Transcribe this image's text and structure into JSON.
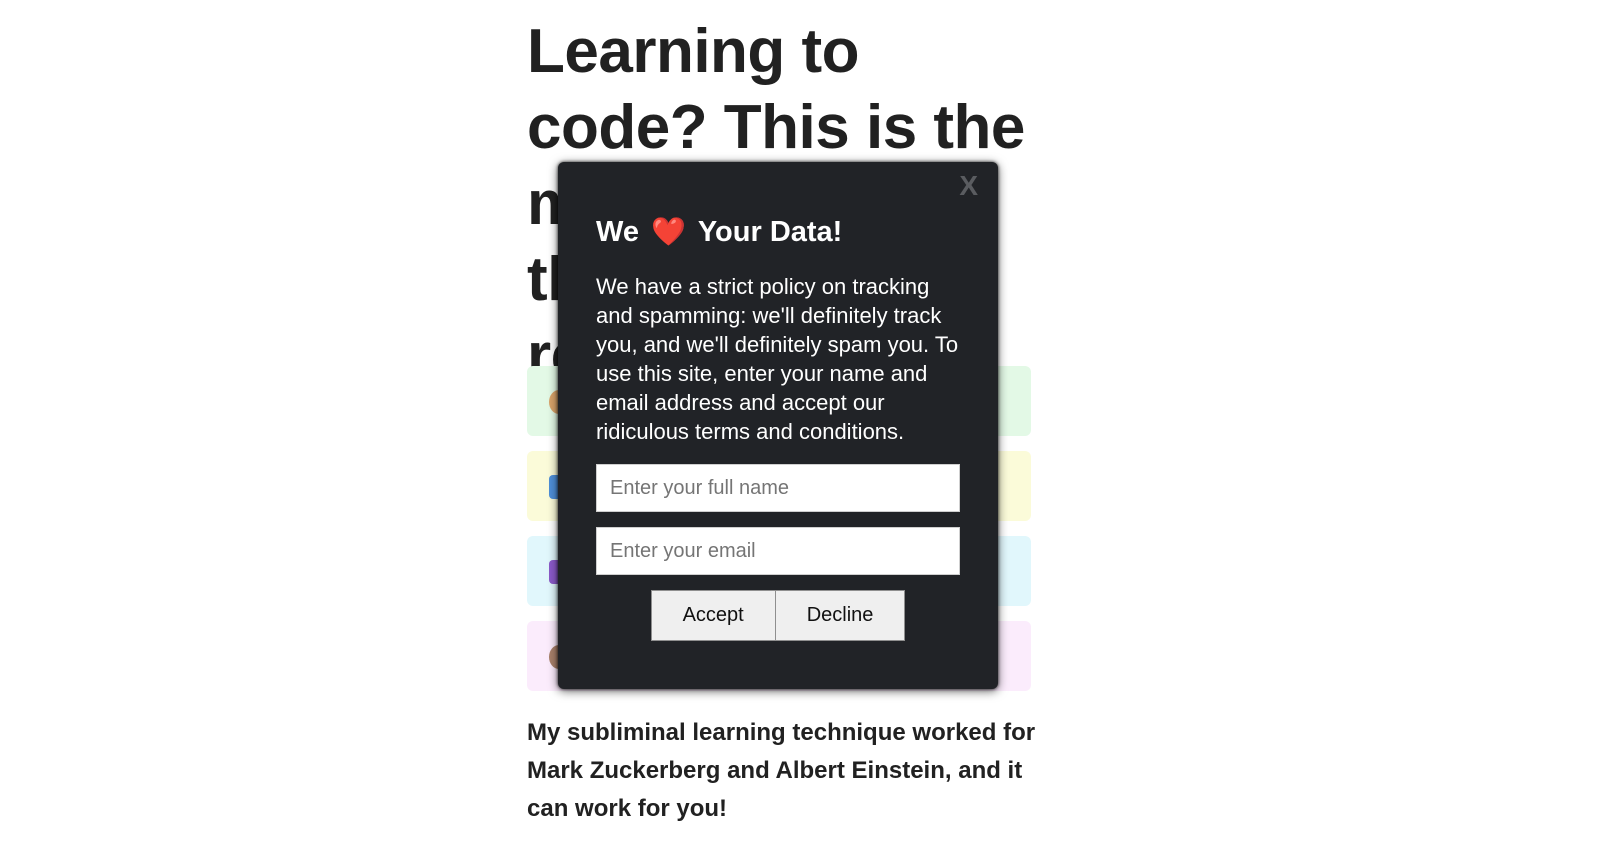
{
  "article": {
    "headline": "Learning to code? This is the most important thing you'll ever read!",
    "subtext": "My subliminal learning technique worked for Mark Zuckerberg and Albert Einstein, and it can work for you!"
  },
  "modal": {
    "title_prefix": "We",
    "heart": "❤️",
    "title_suffix": "Your Data!",
    "close_label": "X",
    "body": "We have a strict policy on tracking and spamming: we'll definitely track you, and we'll definitely spam you. To use this site, enter your name and email address and accept our ridiculous terms and conditions.",
    "name_placeholder": "Enter your full name",
    "email_placeholder": "Enter your email",
    "accept_label": "Accept",
    "decline_label": "Decline"
  },
  "colors": {
    "modal_bg": "#212327",
    "heart": "#e8202e",
    "card_green": "#e3f9e6",
    "card_yellow": "#fbfbd9",
    "card_blue": "#e1f7fc",
    "card_pink": "#fbecfc"
  },
  "icons": [
    "close-icon",
    "heart-icon"
  ]
}
